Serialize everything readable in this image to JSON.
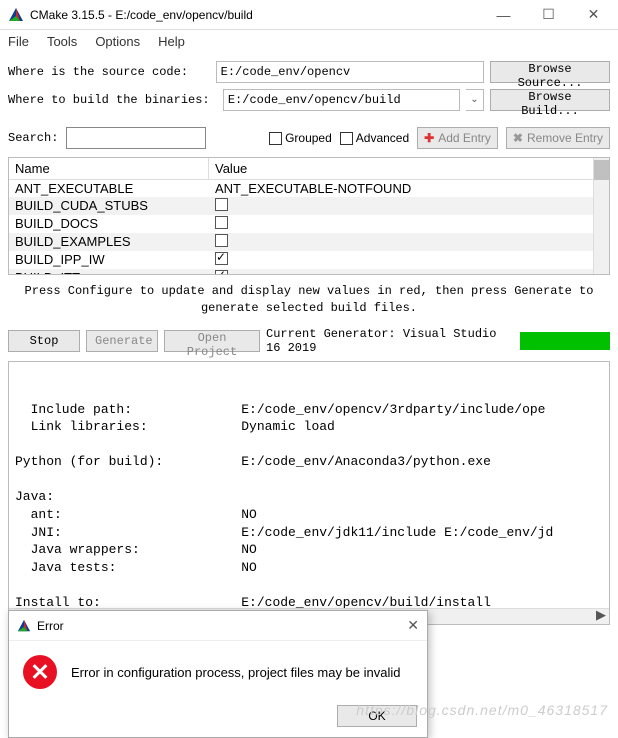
{
  "window": {
    "title": "CMake 3.15.5 - E:/code_env/opencv/build"
  },
  "menu": [
    "File",
    "Tools",
    "Options",
    "Help"
  ],
  "form": {
    "source_label": "Where is the source code:   ",
    "source_value": "E:/code_env/opencv",
    "source_browse": "Browse Source...",
    "build_label": "Where to build the binaries: ",
    "build_value": "E:/code_env/opencv/build",
    "build_browse": "Browse Build..."
  },
  "search": {
    "label": "Search: ",
    "grouped": "Grouped",
    "advanced": "Advanced",
    "add_entry": "Add Entry",
    "remove_entry": "Remove Entry"
  },
  "table": {
    "headers": {
      "name": "Name",
      "value": "Value"
    },
    "rows": [
      {
        "name": "ANT_EXECUTABLE",
        "value_text": "ANT_EXECUTABLE-NOTFOUND",
        "checkbox": null
      },
      {
        "name": "BUILD_CUDA_STUBS",
        "value_text": "",
        "checkbox": false
      },
      {
        "name": "BUILD_DOCS",
        "value_text": "",
        "checkbox": false
      },
      {
        "name": "BUILD_EXAMPLES",
        "value_text": "",
        "checkbox": false
      },
      {
        "name": "BUILD_IPP_IW",
        "value_text": "",
        "checkbox": true
      },
      {
        "name": "BUILD_ITT",
        "value_text": "",
        "checkbox": true
      }
    ]
  },
  "hint": "Press Configure to update and display new values in red, then press Generate to generate selected build files.",
  "actions": {
    "stop": "Stop",
    "generate": "Generate",
    "open_project": "Open Project",
    "current_generator": "Current Generator: Visual Studio 16 2019"
  },
  "output_text": "  Include path:              E:/code_env/opencv/3rdparty/include/ope\n  Link libraries:            Dynamic load\n\nPython (for build):          E:/code_env/Anaconda3/python.exe\n\nJava:\n  ant:                       NO\n  JNI:                       E:/code_env/jdk11/include E:/code_env/jd\n  Java wrappers:             NO\n  Java tests:                NO\n\nInstall to:                  E:/code_env/opencv/build/install\n-----------------------------------------------------------------\n\nConfiguring incomplete, errors occurred!\nSee also \"E:/code_env/opencv/build/CMakeFiles/CMakeOutput.log\".",
  "dialog": {
    "title": "Error",
    "message": "Error in configuration process, project files may be invalid",
    "ok": "OK"
  },
  "watermark": "https://blog.csdn.net/m0_46318517"
}
